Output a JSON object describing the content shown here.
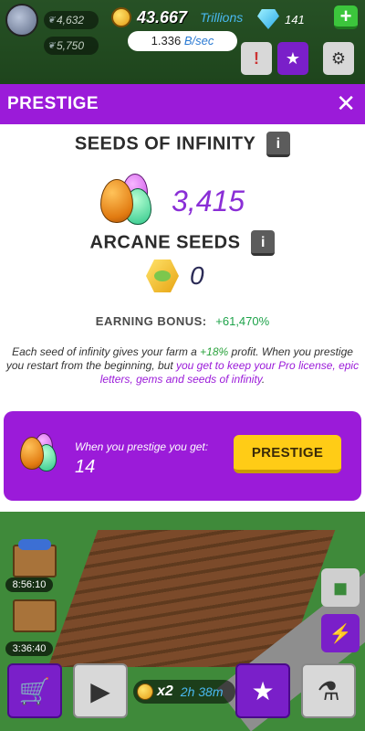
{
  "hud": {
    "stat_1": "4,632",
    "stat_2": "5,750",
    "coins": "43.667",
    "coins_unit": "Trillions",
    "gems": "141",
    "rate_value": "1.336",
    "rate_unit": "B/sec"
  },
  "modal": {
    "title": "PRESTIGE",
    "seeds_title": "SEEDS OF INFINITY",
    "seeds_value": "3,415",
    "arcane_title": "ARCANE SEEDS",
    "arcane_value": "0",
    "bonus_label": "EARNING BONUS:",
    "bonus_value": "+61,470%",
    "desc_1": "Each seed of infinity gives your farm a ",
    "desc_highlight": "+18%",
    "desc_2": " profit. When you prestige you restart from the beginning, but ",
    "desc_purple": "you get to keep your Pro license, epic letters, gems and seeds of infinity",
    "desc_end": ".",
    "get_label": "When you prestige you get:",
    "get_value": "14",
    "prestige_button": "PRESTIGE"
  },
  "farm": {
    "timer_1": "8:56:10",
    "timer_2": "3:36:40",
    "boost_multiplier": "x2",
    "boost_time": "2h 38m"
  },
  "colors": {
    "purple": "#9b1bd9",
    "seeds_value": "#8a2ed6",
    "bonus_green": "#1ea34a",
    "prestige_yellow": "#ffcc16"
  }
}
